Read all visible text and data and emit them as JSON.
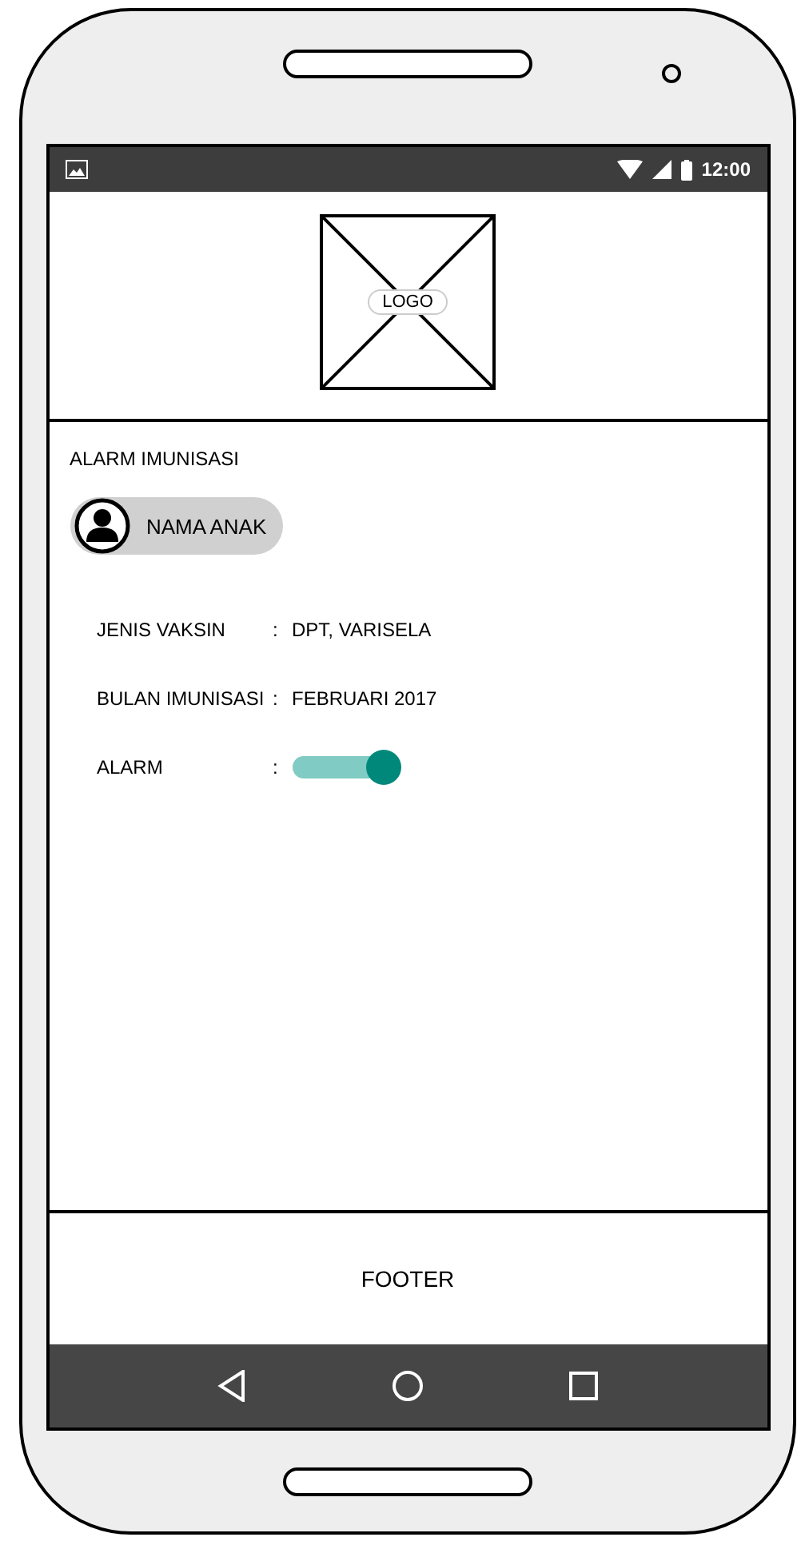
{
  "status_bar": {
    "time": "12:00"
  },
  "header": {
    "logo_label": "LOGO"
  },
  "title": "ALARM IMUNISASI",
  "child": {
    "name": "NAMA ANAK"
  },
  "fields": [
    {
      "kind": "text",
      "label": "JENIS VAKSIN",
      "separator": ":",
      "value": "DPT, VARISELA"
    },
    {
      "kind": "text",
      "label": "BULAN IMUNISASI",
      "separator": ":",
      "value": "FEBRUARI 2017"
    },
    {
      "kind": "toggle",
      "label": "ALARM",
      "separator": ":",
      "on": true
    }
  ],
  "footer": {
    "text": "FOOTER"
  }
}
